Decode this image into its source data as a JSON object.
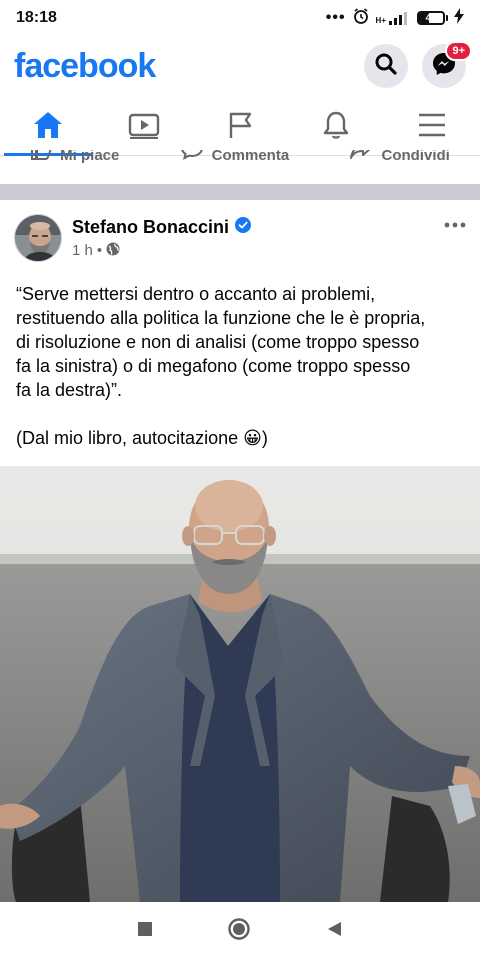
{
  "status_bar": {
    "time": "18:18",
    "dots": "•••",
    "network_top": "H+",
    "battery_level": "43",
    "battery_fraction": 0.43
  },
  "header": {
    "logo": "facebook",
    "messenger_badge": "9+"
  },
  "nav_tabs": [
    {
      "icon": "home-icon",
      "active": true
    },
    {
      "icon": "video-icon",
      "active": false
    },
    {
      "icon": "flag-icon",
      "active": false
    },
    {
      "icon": "bell-icon",
      "active": false
    },
    {
      "icon": "menu-icon",
      "active": false
    }
  ],
  "prev_post_actions": {
    "like": "Mi piace",
    "comment": "Commenta",
    "share": "Condividi"
  },
  "post": {
    "author": "Stefano Bonaccini",
    "verified": true,
    "time": "1 h",
    "separator": "•",
    "privacy_icon": "globe-icon",
    "lines": [
      "“Serve mettersi dentro o accanto ai problemi,",
      "restituendo alla politica la funzione che le è propria,",
      "di risoluzione e non di analisi (come troppo spesso",
      "fa la sinistra) o di megafono (come troppo spesso",
      "fa la destra)”."
    ],
    "note_prefix": "(Dal mio libro, autocitazione ",
    "note_emoji": "😀",
    "note_suffix": ")"
  },
  "colors": {
    "brand": "#1877f2",
    "badge": "#e41e3f",
    "secondary_text": "#65676b",
    "divider": "#c9ccd1"
  }
}
